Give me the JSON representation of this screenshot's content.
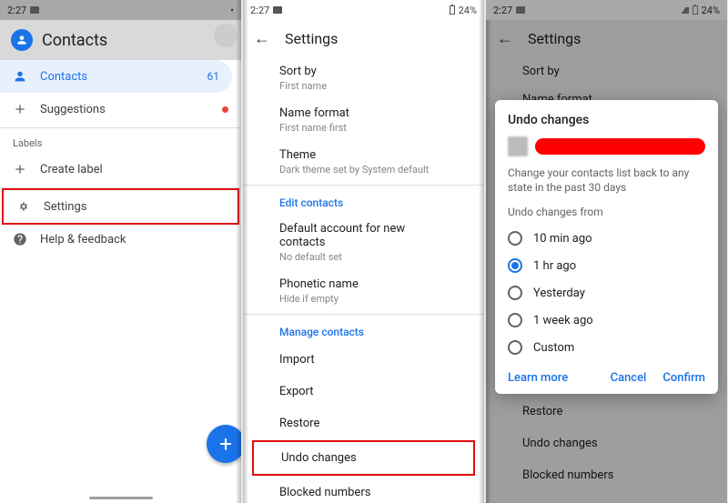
{
  "status": {
    "time": "2:27",
    "battery": "24%"
  },
  "phone1": {
    "app_title": "Contacts",
    "nav": {
      "contacts": "Contacts",
      "contacts_count": "61",
      "suggestions": "Suggestions"
    },
    "labels_header": "Labels",
    "create_label": "Create label",
    "settings": "Settings",
    "help": "Help & feedback"
  },
  "phone2": {
    "title": "Settings",
    "sort_by": {
      "t": "Sort by",
      "s": "First name"
    },
    "name_format": {
      "t": "Name format",
      "s": "First name first"
    },
    "theme": {
      "t": "Theme",
      "s": "Dark theme set by System default"
    },
    "group_edit": "Edit contacts",
    "default_account": {
      "t": "Default account for new contacts",
      "s": "No default set"
    },
    "phonetic": {
      "t": "Phonetic name",
      "s": "Hide if empty"
    },
    "group_manage": "Manage contacts",
    "import": "Import",
    "export": "Export",
    "restore": "Restore",
    "undo": "Undo changes",
    "blocked": "Blocked numbers"
  },
  "phone3": {
    "bg": {
      "title": "Settings",
      "sort_by": "Sort by",
      "name_format": "Name format",
      "restore": "Restore",
      "undo": "Undo changes",
      "blocked": "Blocked numbers"
    },
    "dialog": {
      "title": "Undo changes",
      "desc": "Change your contacts list back to any state in the past 30 days",
      "field_label": "Undo changes from",
      "options": {
        "o1": "10 min ago",
        "o2": "1 hr ago",
        "o3": "Yesterday",
        "o4": "1 week ago",
        "o5": "Custom"
      },
      "learn_more": "Learn more",
      "cancel": "Cancel",
      "confirm": "Confirm"
    }
  }
}
